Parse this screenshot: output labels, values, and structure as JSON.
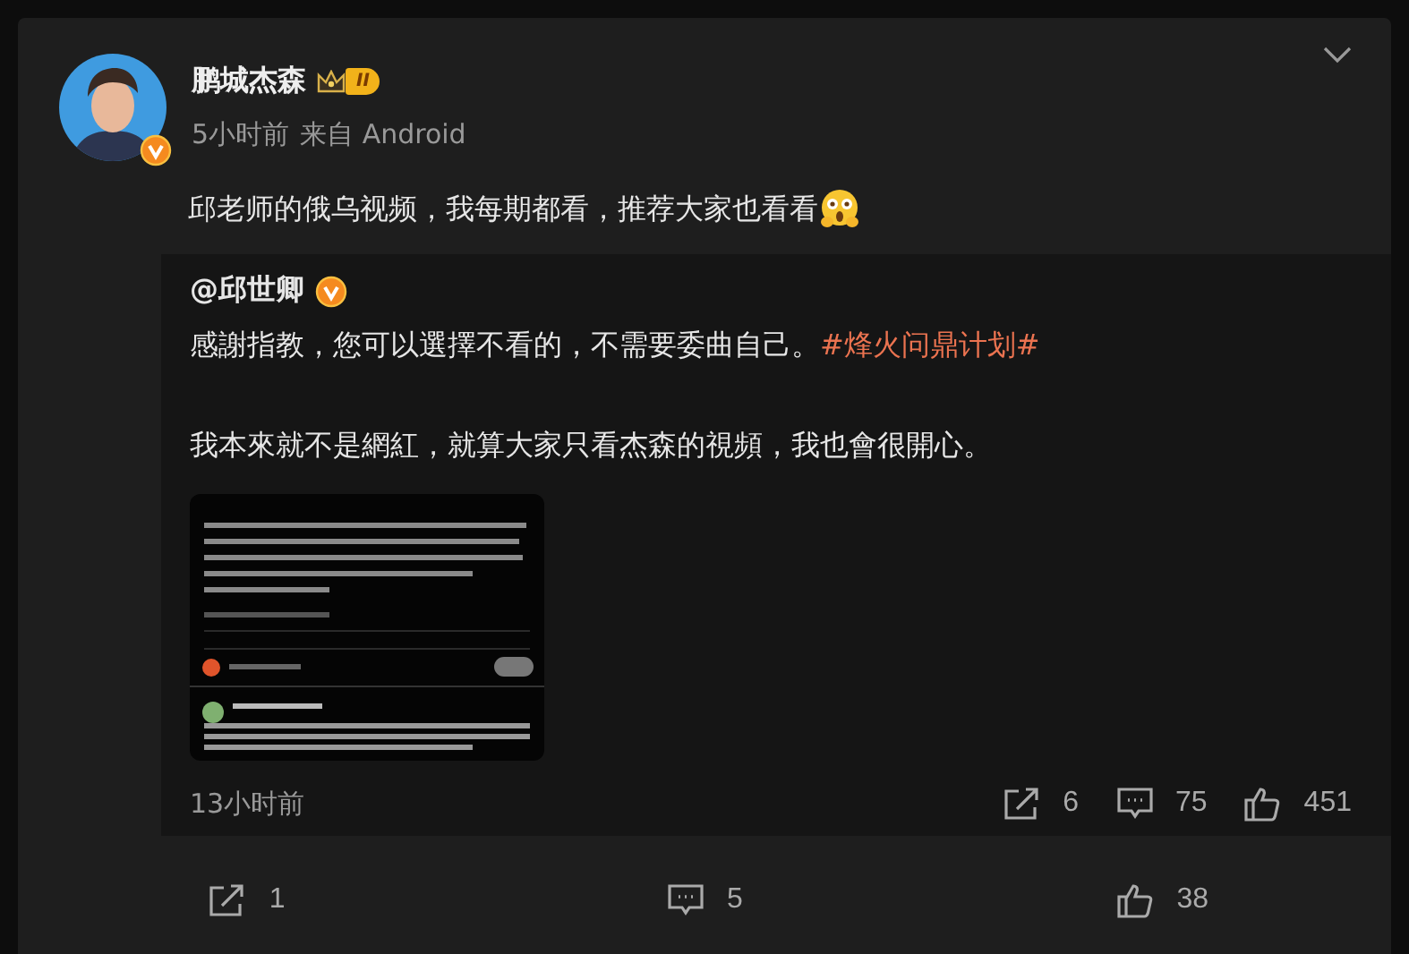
{
  "post": {
    "author": "鹏城杰森",
    "level_badge": "II",
    "verified": true,
    "time": "5小时前",
    "source": "来自 Android",
    "text": "邱老师的俄乌视频，我每期都看，推荐大家也看看",
    "repost": {
      "author": "@邱世卿",
      "verified": true,
      "paragraphs": [
        [
          {
            "kind": "text",
            "text": "感謝指教，您可以選擇不看的，不需要委曲自己。"
          },
          {
            "kind": "hashtag",
            "text": "#烽火问鼎计划#"
          }
        ],
        [
          {
            "kind": "text",
            "text": "我本來就不是網紅，就算大家只看杰森的視頻，我也會很開心。"
          }
        ]
      ],
      "image": {
        "kind": "picture"
      },
      "time": "13小时前",
      "actions": [
        {
          "kind": "share",
          "count": "6"
        },
        {
          "kind": "comment",
          "count": "75"
        },
        {
          "kind": "like",
          "count": "451"
        }
      ]
    },
    "actions": [
      {
        "kind": "share",
        "count": "1"
      },
      {
        "kind": "comment",
        "count": "5"
      },
      {
        "kind": "like",
        "count": "38"
      }
    ]
  }
}
